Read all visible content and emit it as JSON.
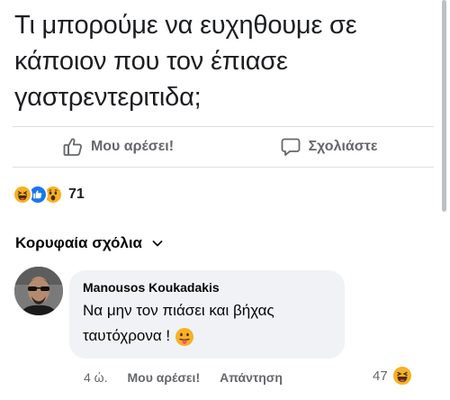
{
  "post": {
    "text_line1": "Τι μπορούμε να ευχηθουμε σε",
    "text_line2": "κάποιον που τον έπιασε",
    "text_line3": "γαστρεντεριτιδα;"
  },
  "actions": {
    "like_label": "Μου αρέσει!",
    "comment_label": "Σχολιάστε"
  },
  "reactions": {
    "count": "71",
    "types": [
      "haha",
      "like",
      "wow"
    ]
  },
  "comments_header": {
    "label": "Κορυφαία σχόλια"
  },
  "comment": {
    "author": "Manousos Koukadakis",
    "text_line1": "Να μην τον πιάσει και βήχας",
    "text_line2": "ταυτόχρονα !",
    "emoji": "tongue-out",
    "time": "4 ώ.",
    "like_label": "Μου αρέσει!",
    "reply_label": "Απάντηση",
    "reaction_count": "47",
    "reaction_type": "haha"
  },
  "colors": {
    "secondary_text": "#65676b",
    "bubble_bg": "#f0f2f5",
    "like_blue": "#1877f2",
    "emoji_yellow": "#f7b125"
  }
}
